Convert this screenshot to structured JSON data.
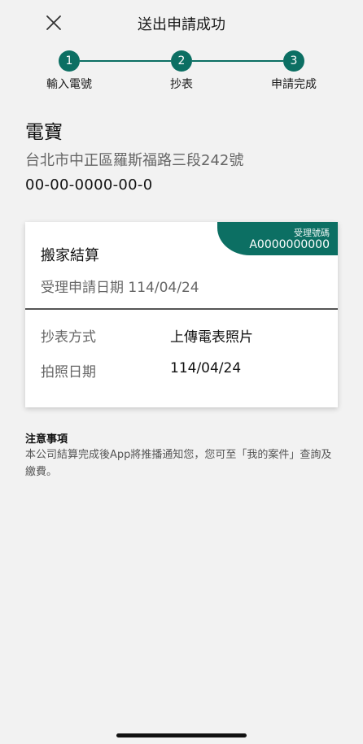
{
  "header": {
    "title": "送出申請成功",
    "close_icon": "close-icon"
  },
  "stepper": {
    "active_color": "#0c6f63",
    "steps": [
      {
        "number": "1",
        "label": "輸入電號"
      },
      {
        "number": "2",
        "label": "抄表"
      },
      {
        "number": "3",
        "label": "申請完成"
      }
    ]
  },
  "address": {
    "title": "電寶",
    "line": "台北市中正區羅斯福路三段242號",
    "number": "00-00-0000-00-0"
  },
  "card": {
    "ticket_label": "受理號碼",
    "ticket_value": "A0000000000",
    "title": "搬家結算",
    "date_line": "受理申請日期 114/04/24",
    "rows": [
      {
        "label": "抄表方式",
        "value": "上傳電表照片"
      },
      {
        "label": "拍照日期",
        "value": "114/04/24"
      }
    ]
  },
  "notes": {
    "heading": "注意事項",
    "body": "本公司結算完成後App將推播通知您，您可至「我的案件」查詢及繳費。"
  }
}
